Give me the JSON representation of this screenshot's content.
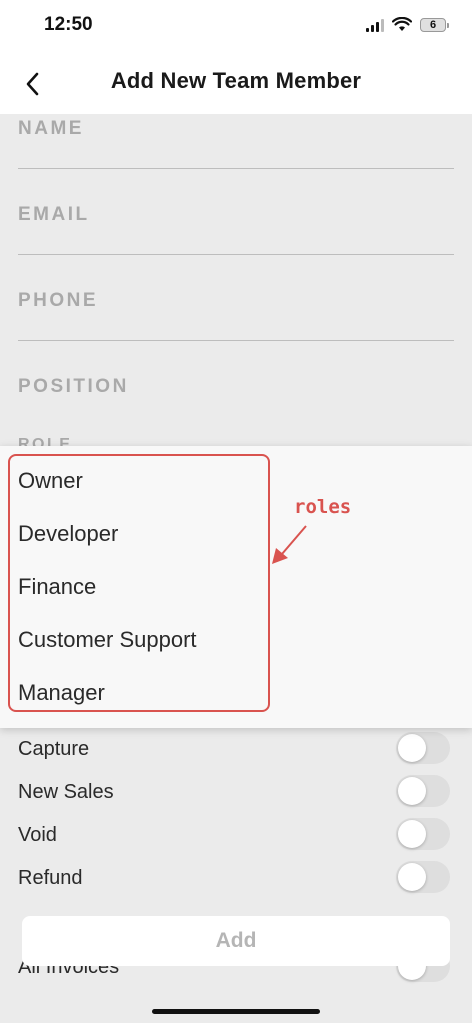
{
  "status_bar": {
    "time": "12:50",
    "battery": "6"
  },
  "header": {
    "title": "Add New Team Member"
  },
  "form": {
    "name_label": "NAME",
    "email_label": "EMAIL",
    "phone_label": "PHONE",
    "position_label": "POSITION",
    "role_label": "ROLE"
  },
  "role_dropdown": {
    "options": [
      "Owner",
      "Developer",
      "Finance",
      "Customer Support",
      "Manager"
    ]
  },
  "annotation": {
    "text": "roles",
    "color": "#d9534f"
  },
  "permissions": [
    {
      "label": "Capture",
      "enabled": false
    },
    {
      "label": "New Sales",
      "enabled": false
    },
    {
      "label": "Void",
      "enabled": false
    },
    {
      "label": "Refund",
      "enabled": false
    },
    {
      "label": "All Invoices",
      "enabled": false
    }
  ],
  "actions": {
    "add_label": "Add"
  }
}
